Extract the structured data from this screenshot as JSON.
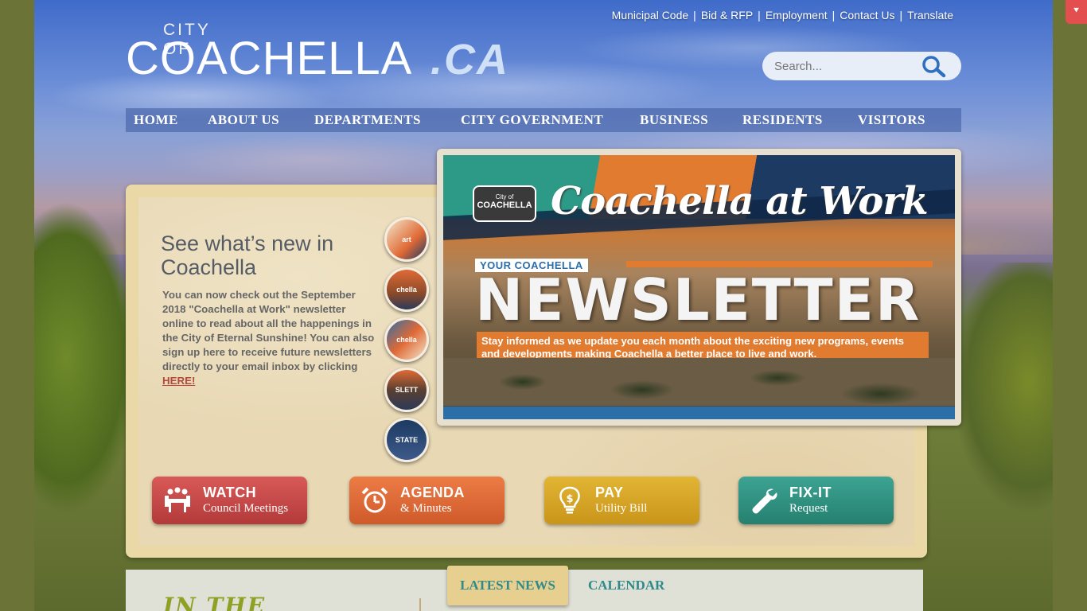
{
  "toplinks": [
    {
      "label": "Municipal Code"
    },
    {
      "label": "Bid & RFP"
    },
    {
      "label": "Employment"
    },
    {
      "label": "Contact Us"
    },
    {
      "label": "Translate"
    }
  ],
  "logo": {
    "city_of": "CITY OF",
    "name": "COACHELLA",
    "suffix": ".CA"
  },
  "search": {
    "placeholder": "Search..."
  },
  "nav": [
    {
      "label": "HOME"
    },
    {
      "label": "ABOUT US"
    },
    {
      "label": "DEPARTMENTS"
    },
    {
      "label": "CITY GOVERNMENT"
    },
    {
      "label": "BUSINESS"
    },
    {
      "label": "RESIDENTS"
    },
    {
      "label": "VISITORS"
    }
  ],
  "feature": {
    "title": "See what’s new in Coachella",
    "body": "You can now check out the September 2018 \"Coachella at Work\" newsletter online to read about all the happenings in the City of Eternal Sunshine! You can also sign up here to receive future newsletters directly to your email inbox by clicking ",
    "link": "HERE!"
  },
  "slide": {
    "badge_top": "City of",
    "badge": "COACHELLA",
    "script_title": "Coachella at Work",
    "your_coachella": "YOUR COACHELLA",
    "headline": "NEWSLETTER",
    "tagline": "Stay informed as we update you each month about the exciting new programs, events and developments making Coachella a better place to live and work."
  },
  "thumbnails": [
    {
      "label": "art"
    },
    {
      "label": "chella"
    },
    {
      "label": "chella"
    },
    {
      "label": "SLETT"
    },
    {
      "label": "STATE CITY"
    }
  ],
  "quick_buttons": [
    {
      "line1": "WATCH",
      "line2": "Council Meetings",
      "color": "#c94a4a"
    },
    {
      "line1": "AGENDA",
      "line2": "& Minutes",
      "color": "#e06a36"
    },
    {
      "line1": "PAY",
      "line2": "Utility Bill",
      "color": "#d6a521"
    },
    {
      "line1": "FIX-IT",
      "line2": "Request",
      "color": "#2f8f80"
    }
  ],
  "tabs": {
    "latest": "LATEST NEWS",
    "calendar": "CALENDAR"
  },
  "news_heading": "IN THE"
}
